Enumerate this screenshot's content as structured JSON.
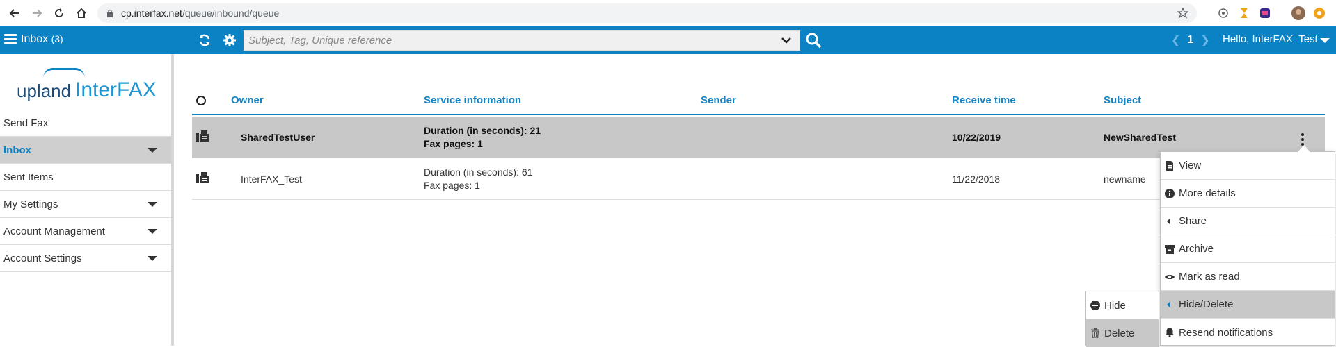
{
  "browser": {
    "url_host": "cp.interfax.net",
    "url_path": "/queue/inbound/queue"
  },
  "header": {
    "inbox_label": "Inbox",
    "inbox_count": "(3)",
    "search_placeholder": "Subject, Tag, Unique reference",
    "page_number": "1",
    "greeting": "Hello, InterFAX_Test",
    "bg_color": "#0a82c4"
  },
  "logo": {
    "upland": "upland",
    "interfax": "InterFAX"
  },
  "sidebar": {
    "items": [
      {
        "label": "Send Fax"
      },
      {
        "label": "Inbox"
      },
      {
        "label": "Sent Items"
      },
      {
        "label": "My Settings"
      },
      {
        "label": "Account Management"
      },
      {
        "label": "Account Settings"
      }
    ]
  },
  "table": {
    "columns": [
      "Owner",
      "Service information",
      "Sender",
      "Receive time",
      "Subject"
    ],
    "rows": [
      {
        "owner": "SharedTestUser",
        "duration": "Duration (in seconds): 21",
        "pages": "Fax pages: 1",
        "sender": "",
        "receive_time": "10/22/2019",
        "subject": "NewSharedTest"
      },
      {
        "owner": "InterFAX_Test",
        "duration": "Duration (in seconds): 61",
        "pages": "Fax pages: 1",
        "sender": "",
        "receive_time": "11/22/2018",
        "subject": "newname"
      }
    ]
  },
  "context_menu": {
    "items": [
      {
        "label": "View",
        "icon": "document-icon"
      },
      {
        "label": "More details",
        "icon": "info-icon"
      },
      {
        "label": "Share",
        "icon": "caret-left-icon"
      },
      {
        "label": "Archive",
        "icon": "archive-icon"
      },
      {
        "label": "Mark as read",
        "icon": "eye-icon"
      },
      {
        "label": "Hide/Delete",
        "icon": "caret-left-icon"
      },
      {
        "label": "Resend notifications",
        "icon": "bell-icon"
      }
    ],
    "submenu": [
      {
        "label": "Hide",
        "icon": "minus-circle-icon"
      },
      {
        "label": "Delete",
        "icon": "trash-icon"
      }
    ]
  }
}
